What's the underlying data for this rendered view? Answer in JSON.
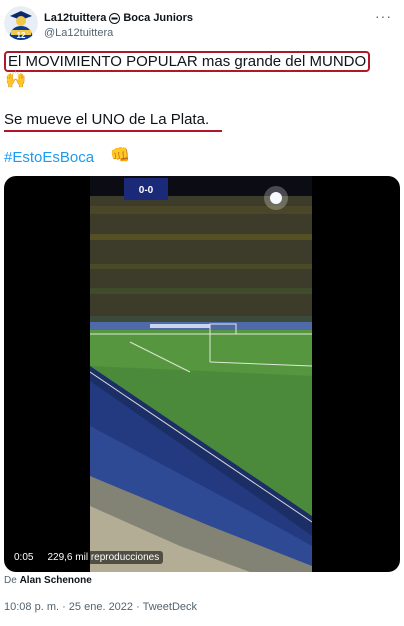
{
  "author": {
    "display_name": "La12tuittera",
    "affiliation": "Boca Juniors",
    "handle": "@La12tuittera",
    "avatar_label": "12"
  },
  "more_label": "···",
  "tweet": {
    "line1": "El MOVIMIENTO POPULAR mas grande del MUNDO",
    "line1_emoji": "🙌",
    "line2": "Se mueve el UNO de La Plata.",
    "hashtag": "#EstoEsBoca",
    "hashtag_emoji": "👊"
  },
  "video": {
    "time": "0:05",
    "views": "229,6 mil reproducciones",
    "scoreboard": "0-0"
  },
  "credit": {
    "prefix": "De",
    "name": "Alan Schenone"
  },
  "meta": "10:08 p. m. · 25 ene. 2022 · TweetDeck",
  "colors": {
    "accent_red": "#b0182a",
    "link_blue": "#1d9bf0",
    "muted": "#536471"
  }
}
